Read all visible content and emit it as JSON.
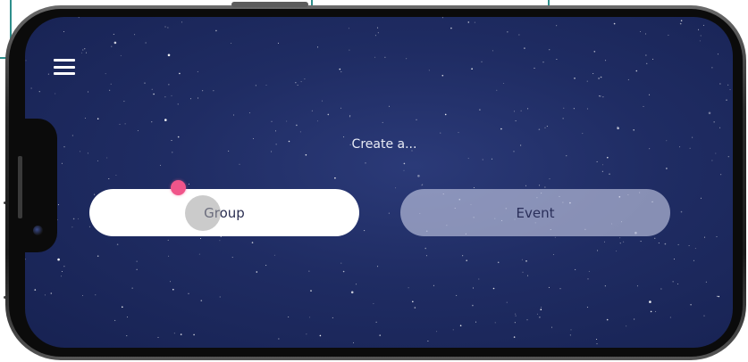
{
  "header": {
    "menu_icon": "hamburger-menu-icon"
  },
  "prompt": {
    "label": "Create a..."
  },
  "options": {
    "group_label": "Group",
    "event_label": "Event"
  },
  "colors": {
    "background": "#1f2c63",
    "selected_button": "#ffffff",
    "unselected_button": "#c8cde6",
    "touch_indicator": "#f0558a"
  }
}
